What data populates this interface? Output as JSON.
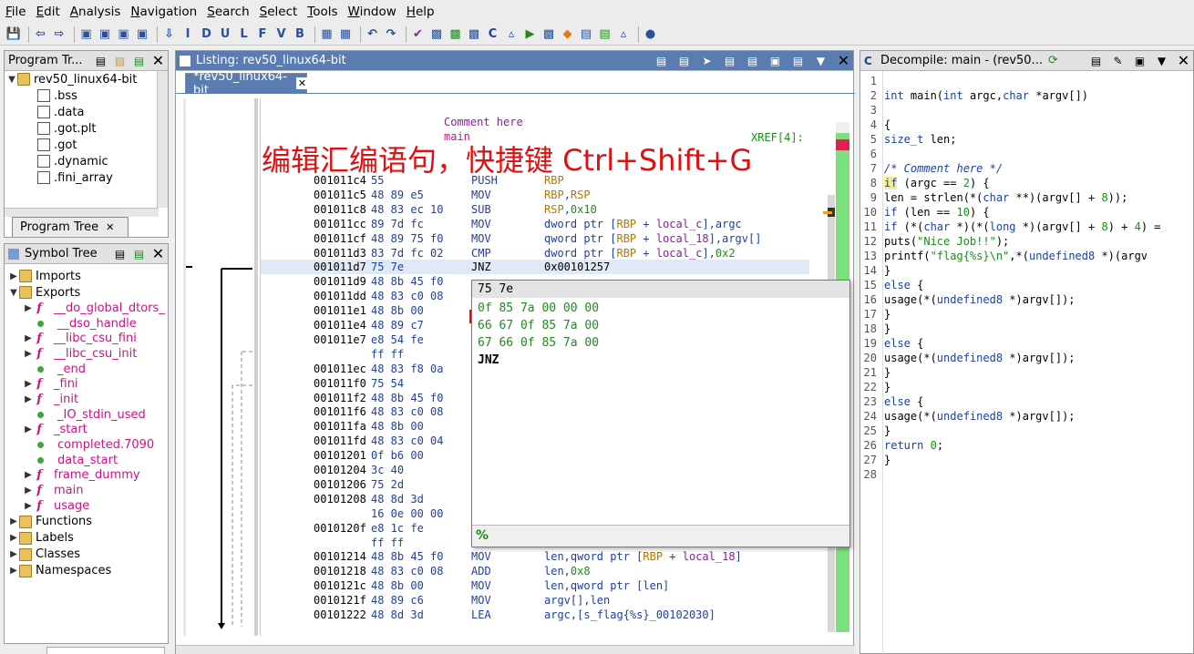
{
  "menu": [
    "File",
    "Edit",
    "Analysis",
    "Navigation",
    "Search",
    "Select",
    "Tools",
    "Window",
    "Help"
  ],
  "toolbar_letters": [
    "I",
    "D",
    "U",
    "L",
    "F",
    "V",
    "B"
  ],
  "program_tree": {
    "title": "Program Tr...",
    "root": "rev50_linux64-bit",
    "items": [
      ".bss",
      ".data",
      ".got.plt",
      ".got",
      ".dynamic",
      ".fini_array"
    ],
    "tab": "Program Tree"
  },
  "symbol_tree": {
    "title": "Symbol Tree",
    "imports": "Imports",
    "exports": "Exports",
    "exports_items": [
      {
        "label": "__do_global_dtors_",
        "kind": "func"
      },
      {
        "label": "__dso_handle",
        "kind": "data"
      },
      {
        "label": "__libc_csu_fini",
        "kind": "func"
      },
      {
        "label": "__libc_csu_init",
        "kind": "func"
      },
      {
        "label": "_end",
        "kind": "data"
      },
      {
        "label": "_fini",
        "kind": "func"
      },
      {
        "label": "_init",
        "kind": "func"
      },
      {
        "label": "_IO_stdin_used",
        "kind": "data"
      },
      {
        "label": "_start",
        "kind": "func"
      },
      {
        "label": "completed.7090",
        "kind": "data"
      },
      {
        "label": "data_start",
        "kind": "data"
      },
      {
        "label": "frame_dummy",
        "kind": "func"
      },
      {
        "label": "main",
        "kind": "func"
      },
      {
        "label": "usage",
        "kind": "func"
      }
    ],
    "others": [
      "Functions",
      "Labels",
      "Classes",
      "Namespaces"
    ]
  },
  "listing": {
    "title": "Listing:  rev50_linux64-bit",
    "tab": "*rev50_linux64-bit",
    "comment": "Comment here",
    "func_label": "main",
    "xref": "XREF[4]:",
    "rows": [
      {
        "addr": "001011c4",
        "bytes": "55",
        "mnem": "PUSH",
        "ops": "RBP"
      },
      {
        "addr": "001011c5",
        "bytes": "48 89 e5",
        "mnem": "MOV",
        "ops": "RBP,RSP"
      },
      {
        "addr": "001011c8",
        "bytes": "48 83 ec 10",
        "mnem": "SUB",
        "ops": "RSP,0x10"
      },
      {
        "addr": "001011cc",
        "bytes": "89 7d fc",
        "mnem": "MOV",
        "ops": "dword ptr [RBP + local_c],argc"
      },
      {
        "addr": "001011cf",
        "bytes": "48 89 75 f0",
        "mnem": "MOV",
        "ops": "qword ptr [RBP + local_18],argv[]"
      },
      {
        "addr": "001011d3",
        "bytes": "83 7d fc 02",
        "mnem": "CMP",
        "ops": "dword ptr [RBP + local_c],0x2"
      },
      {
        "addr": "001011d7",
        "bytes": "75 7e",
        "mnem": "JNZ",
        "ops": "0x00101257"
      },
      {
        "addr": "001011d9",
        "bytes": "48 8b 45 f0",
        "mnem": "",
        "ops": ""
      },
      {
        "addr": "001011dd",
        "bytes": "48 83 c0 08",
        "mnem": "",
        "ops": ""
      },
      {
        "addr": "001011e1",
        "bytes": "48 8b 00",
        "mnem": "",
        "ops": ""
      },
      {
        "addr": "001011e4",
        "bytes": "48 89 c7",
        "mnem": "",
        "ops": ""
      },
      {
        "addr": "001011e7",
        "bytes": "e8 54 fe",
        "mnem": "",
        "ops": ""
      },
      {
        "addr": "",
        "bytes": "ff ff",
        "mnem": "",
        "ops": ""
      },
      {
        "addr": "001011ec",
        "bytes": "48 83 f8 0a",
        "mnem": "",
        "ops": ""
      },
      {
        "addr": "001011f0",
        "bytes": "75 54",
        "mnem": "",
        "ops": ""
      },
      {
        "addr": "001011f2",
        "bytes": "48 8b 45 f0",
        "mnem": "",
        "ops": ""
      },
      {
        "addr": "001011f6",
        "bytes": "48 83 c0 08",
        "mnem": "",
        "ops": ""
      },
      {
        "addr": "001011fa",
        "bytes": "48 8b 00",
        "mnem": "",
        "ops": ""
      },
      {
        "addr": "001011fd",
        "bytes": "48 83 c0 04",
        "mnem": "",
        "ops": ""
      },
      {
        "addr": "00101201",
        "bytes": "0f b6 00",
        "mnem": "",
        "ops": ""
      },
      {
        "addr": "00101204",
        "bytes": "3c 40",
        "mnem": "",
        "ops": ""
      },
      {
        "addr": "00101206",
        "bytes": "75 2d",
        "mnem": "",
        "ops": ""
      },
      {
        "addr": "00101208",
        "bytes": "48 8d 3d",
        "mnem": "",
        "ops": ""
      },
      {
        "addr": "",
        "bytes": "16 0e 00 00",
        "mnem": "",
        "ops": ""
      },
      {
        "addr": "0010120f",
        "bytes": "e8 1c fe",
        "mnem": "",
        "ops": ""
      },
      {
        "addr": "",
        "bytes": "ff ff",
        "mnem": "",
        "ops": ""
      },
      {
        "addr": "00101214",
        "bytes": "48 8b 45 f0",
        "mnem": "MOV",
        "ops": "len,qword ptr [RBP + local_18]"
      },
      {
        "addr": "00101218",
        "bytes": "48 83 c0 08",
        "mnem": "ADD",
        "ops": "len,0x8"
      },
      {
        "addr": "0010121c",
        "bytes": "48 8b 00",
        "mnem": "MOV",
        "ops": "len,qword ptr [len]"
      },
      {
        "addr": "0010121f",
        "bytes": "48 89 c6",
        "mnem": "MOV",
        "ops": "argv[],len"
      },
      {
        "addr": "00101222",
        "bytes": "48 8d 3d",
        "mnem": "LEA",
        "ops": "argc,[s_flag{%s}_00102030]"
      }
    ]
  },
  "popup": {
    "header": "75 7e",
    "options": [
      "0f 85 7a 00 00 00",
      "66 67 0f 85 7a 00",
      "67 66 0f 85 7a 00"
    ],
    "mnemonic": "JNZ"
  },
  "overlay_text": "编辑汇编语句，快捷键 Ctrl+Shift+G",
  "decompile": {
    "title": "Decompile: main -  (rev50...",
    "lines": [
      "",
      "int main(int argc,char *argv[])",
      "",
      "{",
      "  size_t len;",
      "",
      "                    /* Comment here */",
      "  if (argc == 2) {",
      "    len = strlen(*(char **)(argv[] + 8));",
      "    if (len == 10) {",
      "      if (*(char *)(*(long *)(argv[] + 8) + 4) =",
      "        puts(\"Nice Job!!\");",
      "        printf(\"flag{%s}\\n\",*(undefined8 *)(argv",
      "      }",
      "      else {",
      "        usage(*(undefined8 *)argv[]);",
      "      }",
      "    }",
      "    else {",
      "      usage(*(undefined8 *)argv[]);",
      "    }",
      "  }",
      "  else {",
      "    usage(*(undefined8 *)argv[]);",
      "  }",
      "  return 0;",
      "}",
      ""
    ]
  },
  "colors": {
    "active_header": "#5b7cb0",
    "highlight": "#e01010",
    "magenta": "#d0108a",
    "green_bar": "#7be07b"
  }
}
